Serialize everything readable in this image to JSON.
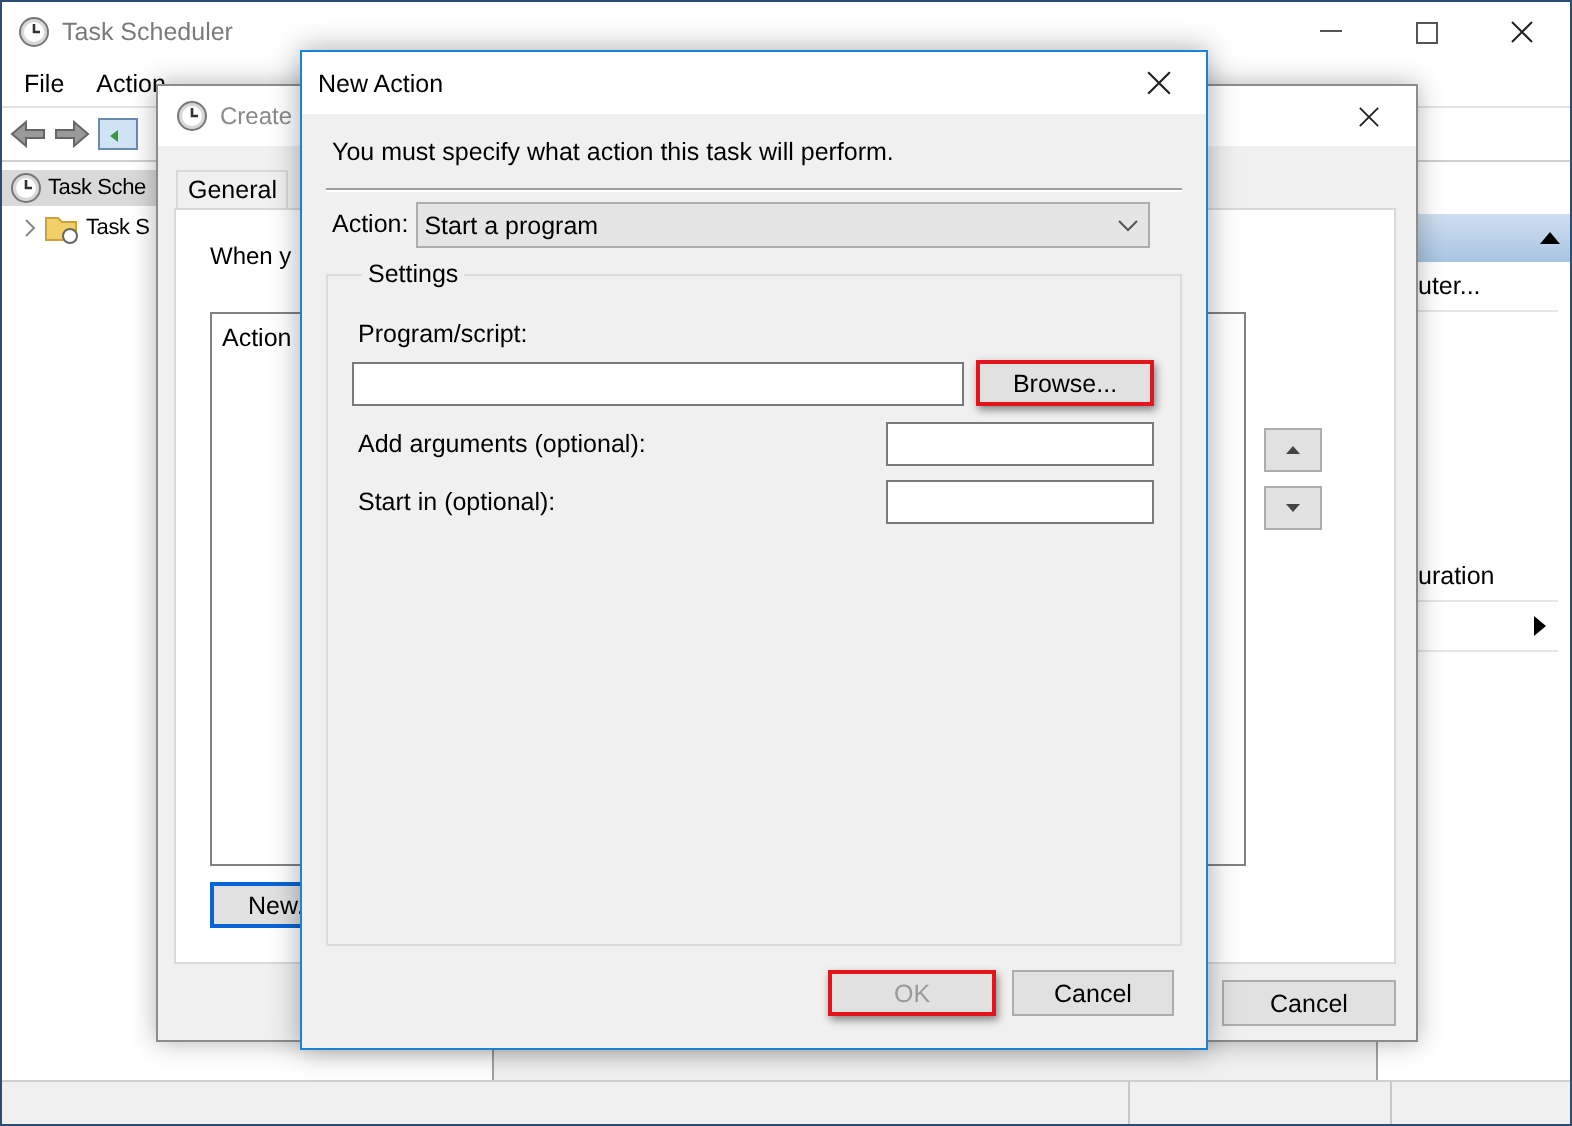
{
  "main_window": {
    "title": "Task Scheduler",
    "menu": [
      "File",
      "Action"
    ],
    "tree": [
      {
        "label": "Task Sche",
        "selected": true,
        "children": [
          {
            "label": "Task S",
            "selected": false,
            "expanded": false
          }
        ]
      }
    ],
    "actions_pane": [
      {
        "kind": "text",
        "label": "uter..."
      },
      {
        "kind": "text",
        "label": "uration"
      },
      {
        "kind": "submenu"
      }
    ]
  },
  "create_task": {
    "title": "Create",
    "tabs": [
      {
        "label": "General",
        "selected": false
      }
    ],
    "intro": "When y",
    "list_column": "Action",
    "new_button": "New.",
    "cancel_button": "Cancel"
  },
  "new_action": {
    "title": "New Action",
    "instruction": "You must specify what action this task will perform.",
    "action_label": "Action:",
    "action_value": "Start a program",
    "settings_label": "Settings",
    "fields": [
      {
        "kind": "stacked",
        "label": "Program/script:"
      },
      {
        "kind": "inline",
        "label": "Add arguments (optional):"
      },
      {
        "kind": "inline",
        "label": "Start in (optional):"
      }
    ],
    "browse": {
      "label": "Browse...",
      "highlighted": true
    },
    "ok": {
      "label": "OK",
      "disabled": true,
      "highlighted": true
    },
    "cancel": {
      "label": "Cancel",
      "disabled": false,
      "highlighted": false
    }
  }
}
